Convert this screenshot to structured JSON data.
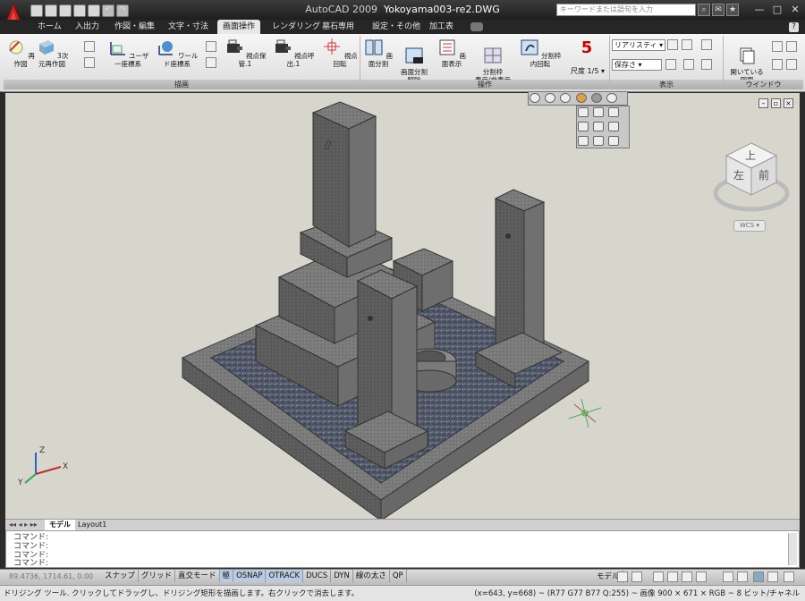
{
  "app": {
    "title": "AutoCAD 2009",
    "file": "Yokoyama003-re2.DWG",
    "search_placeholder": "キーワードまたは語句を入力"
  },
  "tabs": [
    "ホーム",
    "入出力",
    "作図・編集",
    "文字・寸法",
    "画面操作",
    "レンダリング",
    "墓石専用",
    "設定・その他",
    "加工表"
  ],
  "active_tab": "画面操作",
  "ribbon": {
    "draw_panel": {
      "title": "描画",
      "buttons": [
        "再作図",
        "3次元再作図",
        "ユーザー座標系",
        "ワールド座標系",
        "視点保管.1",
        "視点呼出.1",
        "視点回転"
      ]
    },
    "ops_panel": {
      "title": "操作",
      "buttons": [
        "画面分割",
        "画面分割\n解除",
        "画面表示",
        "分割枠\n表示/非表示",
        "分割枠内回転"
      ],
      "scale_value": "5",
      "scale_label": "尺度 1/5"
    },
    "view_panel": {
      "title": "表示",
      "visual_style": "リアリスティ",
      "save_label": "保存さ"
    },
    "window_panel": {
      "title": "ウインドウ",
      "open_label": "開いている\n図面"
    }
  },
  "viewcube": {
    "top": "上",
    "left": "左",
    "front": "前",
    "wcs": "WCS"
  },
  "ucs_axes": {
    "x": "X",
    "y": "Y",
    "z": "Z"
  },
  "layout_tabs": [
    "モデル",
    "Layout1"
  ],
  "command_lines": [
    "コマンド:",
    "コマンド:",
    "コマンド:",
    "コマンド:"
  ],
  "status": {
    "coords": "89.4736, 1714.61, 0.00",
    "toggles": [
      "スナップ",
      "グリッド",
      "直交モード",
      "極",
      "OSNAP",
      "OTRACK",
      "DUCS",
      "DYN",
      "線の太さ",
      "QP"
    ],
    "on_toggles": [
      "極",
      "OSNAP",
      "OTRACK"
    ],
    "model": "モデル"
  },
  "info": {
    "left": "ドリジング ツール. クリックしてドラッグし、ドリジング矩形を描画します。右クリックで消去します。",
    "right": "(x=643, y=668) ~ (R77 G77 B77 Q:255) ~ 画像 900 × 671 × RGB ~ 8 ビット/チャネル"
  },
  "colors": {
    "titlebar": "#262626",
    "ribbon": "#eeeeee",
    "viewport": "#d6d6cd",
    "granite": "#7b7b7b",
    "gravel": "#4e5565"
  }
}
